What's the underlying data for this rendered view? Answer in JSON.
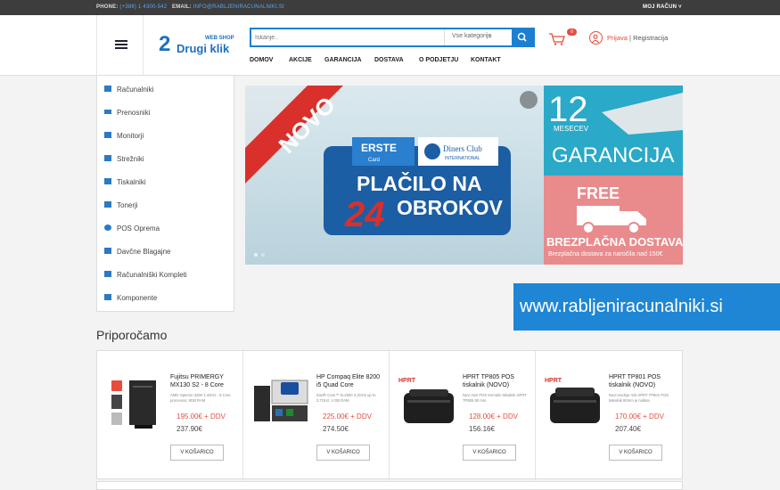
{
  "topbar": {
    "phone_label": "PHONE:",
    "phone_value": "(+386) 1 4300-542",
    "email_label": "EMAIL:",
    "email_value": "INFO@RABLJENIRACUNALNIKI.SI",
    "account": "MOJ RAČUN"
  },
  "logo": {
    "digit": "2",
    "name": "Drugi klik",
    "tag": "WEB SHOP"
  },
  "search": {
    "placeholder": "Iskanje..",
    "category": "Vse kategorije"
  },
  "nav": [
    "DOMOV",
    "AKCIJE",
    "GARANCIJA",
    "DOSTAVA",
    "O PODJETJU",
    "KONTAKT"
  ],
  "cart": {
    "count": "0"
  },
  "user": {
    "login": "Prijava",
    "separator": "|",
    "register": "Registracija"
  },
  "sidebar": [
    {
      "label": "Računalniki",
      "icon": "windows-icon"
    },
    {
      "label": "Prenosniki",
      "icon": "laptop-icon"
    },
    {
      "label": "Monitorji",
      "icon": "monitor-icon"
    },
    {
      "label": "Strežniki",
      "icon": "server-icon"
    },
    {
      "label": "Tiskalniki",
      "icon": "printer-icon"
    },
    {
      "label": "Tonerji",
      "icon": "toner-icon"
    },
    {
      "label": "POS Oprema",
      "icon": "gear-icon"
    },
    {
      "label": "Davčne Blagajne",
      "icon": "register-icon"
    },
    {
      "label": "Računalniški Kompleti",
      "icon": "checkbox-icon"
    },
    {
      "label": "Komponente",
      "icon": "sitemap-icon"
    }
  ],
  "banner": {
    "ribbon": "NOVO",
    "erste": "ERSTE",
    "erste_sub": "Card",
    "diners": "Diners Club",
    "diners_sub": "INTERNATIONAL",
    "line1": "PLAČILO NA",
    "num": "24",
    "line2": "OBROKOV",
    "months_num": "12",
    "months_label": "MESECEV",
    "warranty": "GARANCIJA",
    "free": "FREE",
    "delivery": "BREZPLAČNA DOSTAVA",
    "delivery_note": "Brezplačna dostava za naročila nad 150€"
  },
  "url_text": "www.rabljeniracunalniki.si",
  "section_title": "Priporočamo",
  "products": [
    {
      "title": "Fujitsu PRIMERGY MX130 S2 - 8 Core",
      "desc": "AMD Opteron 3280 2.4GHz - 8 Core processor, 8GB RAM",
      "price_net": "195.00€ + DDV",
      "price": "237.90€",
      "button": "V KOŠARICO",
      "image": "server-tower"
    },
    {
      "title": "HP Compaq Elite 8200 i5 Quad Core",
      "desc": "Intel® Core™ i5-2500 3.3GHz up to 3.7GHz, 4 GB RAM",
      "price_net": "225.00€ + DDV",
      "price": "274.50€",
      "button": "V KOŠARICO",
      "image": "desktop-pc"
    },
    {
      "title": "HPRT TP805 POS tiskalnik (NOVO)",
      "desc": "Novi mini POS termalni tiskalnik HPRT TP805 80 mm",
      "price_net": "128.00€ + DDV",
      "price": "156.16€",
      "button": "V KOŠARICO",
      "image": "pos-printer"
    },
    {
      "title": "HPRT TP801 POS tiskalnik (NOVO)",
      "desc": "Novi srednje miri HPRT TP801 POS tiskalnik 80mm je nalikov",
      "price_net": "170.00€ + DDV",
      "price": "207.40€",
      "button": "V KOŠARICO",
      "image": "pos-printer"
    }
  ],
  "colors": {
    "accent": "#1c7fd1",
    "red": "#e84c3d",
    "topbar": "#3d3d3d",
    "teal": "#2aa9c8",
    "salmon": "#e98a8c"
  }
}
